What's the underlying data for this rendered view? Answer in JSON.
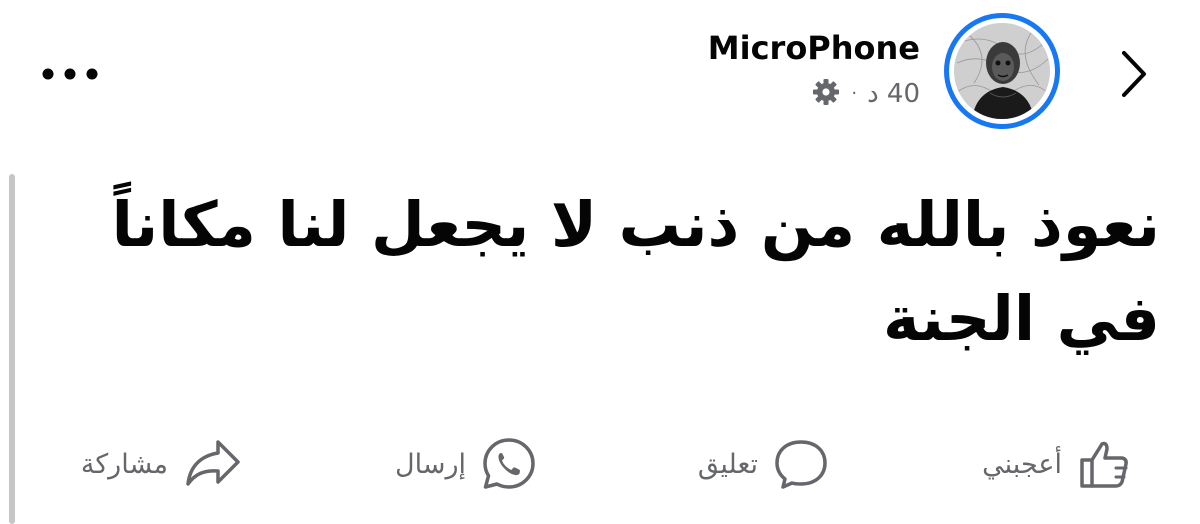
{
  "post": {
    "author": "MicroPhone",
    "time": "40 د",
    "separator": "·",
    "text_line1": "نعوذ بالله من ذنب لا يجعل لنا مكاناً",
    "text_line2": "في الجنة"
  },
  "actions": {
    "like": "أعجبني",
    "comment": "تعليق",
    "send": "إرسال",
    "share": "مشاركة"
  },
  "icons": {
    "back": "chevron-right-icon",
    "more": "more-dots-icon",
    "privacy": "gear-icon",
    "like": "thumbs-up-icon",
    "comment": "comment-bubble-icon",
    "send": "whatsapp-icon",
    "share": "share-arrow-icon"
  },
  "colors": {
    "avatar_ring": "#1877f2",
    "secondary_text": "#65676b",
    "primary_text": "#050505"
  }
}
